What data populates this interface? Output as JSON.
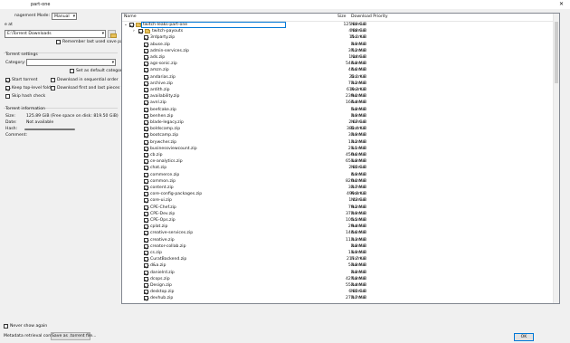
{
  "window": {
    "title": "part-one"
  },
  "management_mode": {
    "label": "nagement Mode:",
    "value": "Manual"
  },
  "save_at": {
    "label": "e at",
    "path": "E:\\Torrent Downloads"
  },
  "remember_last_path": {
    "label": "Remember last used save path",
    "checked": false
  },
  "torrent_settings": {
    "title": "Torrent settings",
    "category_label": "Category:",
    "category_value": "",
    "set_default_category": {
      "label": "Set as default category",
      "checked": false
    },
    "start_torrent": {
      "label": "Start torrent",
      "checked": true
    },
    "sequential": {
      "label": "Download in sequential order",
      "checked": false
    },
    "top_level_folder": {
      "label": "Keep top-level folder",
      "checked": true
    },
    "first_last": {
      "label": "Download first and last pieces first",
      "checked": false
    },
    "skip_hash": {
      "label": "Skip hash check",
      "checked": false
    }
  },
  "torrent_info": {
    "title": "Torrent information",
    "size_label": "Size:",
    "size_value": "125.89 GiB (Free space on disk: 819.50 GiB)",
    "date_label": "Date:",
    "date_value": "Not available",
    "hash_label": "Hash:",
    "comment_label": "Comment:"
  },
  "never_show": {
    "label": "Never show again",
    "checked": false
  },
  "status": {
    "text": "Metadata retrieval complete",
    "save_button": "Save as .torrent file..."
  },
  "ok_button": "OK",
  "tree": {
    "col_name": "Name",
    "col_size": "Size",
    "col_priority": "Download Priority",
    "root": {
      "name": "twitch-leaks-part-one",
      "size": "125.89 GiB",
      "priority": "Normal"
    },
    "folder": {
      "name": "twitch-payouts",
      "size": "4.88 GiB",
      "priority": "Normal"
    },
    "files": [
      {
        "name": "3rdparty.zip",
        "size": "15.1 KiB",
        "priority": "Normal"
      },
      {
        "name": "abuse.zip",
        "size": "3.9 MiB",
        "priority": "Normal"
      },
      {
        "name": "admin-services.zip",
        "size": "37.2 MiB",
        "priority": "Normal"
      },
      {
        "name": "ads.zip",
        "size": "1.14 GiB",
        "priority": "Normal"
      },
      {
        "name": "ags-sonic.zip",
        "size": "544.8 MiB",
        "priority": "Normal"
      },
      {
        "name": "amzn.zip",
        "size": "44.6 MiB",
        "priority": "Normal"
      },
      {
        "name": "andarias.zip",
        "size": "22.1 KiB",
        "priority": "Normal"
      },
      {
        "name": "archive.zip",
        "size": "73.2 MiB",
        "priority": "Normal"
      },
      {
        "name": "ardith.zip",
        "size": "610.3 KiB",
        "priority": "Normal"
      },
      {
        "name": "availability.zip",
        "size": "239.0 MiB",
        "priority": "Normal"
      },
      {
        "name": "avnl.zip",
        "size": "164.4 MiB",
        "priority": "Normal"
      },
      {
        "name": "beefcake.zip",
        "size": "5.8 MiB",
        "priority": "Normal"
      },
      {
        "name": "benhen.zip",
        "size": "3.9 MiB",
        "priority": "Normal"
      },
      {
        "name": "blade-legacy.zip",
        "size": "2.67 GiB",
        "priority": "Normal"
      },
      {
        "name": "boldscamp.zip",
        "size": "382.4 KiB",
        "priority": "Normal"
      },
      {
        "name": "bootcamp.zip",
        "size": "33.9 MiB",
        "priority": "Normal"
      },
      {
        "name": "brywcher.zip",
        "size": "13.2 MiB",
        "priority": "Normal"
      },
      {
        "name": "businessviewcount.zip",
        "size": "21.1 MiB",
        "priority": "Normal"
      },
      {
        "name": "cb.zip",
        "size": "450.6 MiB",
        "priority": "Normal"
      },
      {
        "name": "ce-analytics.zip",
        "size": "651.8 MiB",
        "priority": "Normal"
      },
      {
        "name": "chat.zip",
        "size": "2.85 GiB",
        "priority": "Normal"
      },
      {
        "name": "commerce.zip",
        "size": "4.9 MiB",
        "priority": "Normal"
      },
      {
        "name": "common.zip",
        "size": "820.0 MiB",
        "priority": "Normal"
      },
      {
        "name": "content.zip",
        "size": "32.7 MiB",
        "priority": "Normal"
      },
      {
        "name": "core-config-packages.zip",
        "size": "499.8 KiB",
        "priority": "Normal"
      },
      {
        "name": "core-ui.zip",
        "size": "1.43 GiB",
        "priority": "Normal"
      },
      {
        "name": "CPE-Chef.zip",
        "size": "79.2 MiB",
        "priority": "Normal"
      },
      {
        "name": "CPE-Dev.zip",
        "size": "372.9 MiB",
        "priority": "Normal"
      },
      {
        "name": "CPE-Ops.zip",
        "size": "105.5 MiB",
        "priority": "Normal"
      },
      {
        "name": "cplat.zip",
        "size": "29.4 MiB",
        "priority": "Normal"
      },
      {
        "name": "creative-services.zip",
        "size": "144.6 MiB",
        "priority": "Normal"
      },
      {
        "name": "creative.zip",
        "size": "113.3 MiB",
        "priority": "Normal"
      },
      {
        "name": "creator-collab.zip",
        "size": "2.8 MiB",
        "priority": "Normal"
      },
      {
        "name": "cs.zip",
        "size": "11.9 MiB",
        "priority": "Normal"
      },
      {
        "name": "CuratBackend.zip",
        "size": "217.7 KiB",
        "priority": "Normal"
      },
      {
        "name": "d&a.zip",
        "size": "53.8 MiB",
        "priority": "Normal"
      },
      {
        "name": "danielrd.zip",
        "size": "2.8 MiB",
        "priority": "Normal"
      },
      {
        "name": "dcops.zip",
        "size": "427.8 MiB",
        "priority": "Normal"
      },
      {
        "name": "Design.zip",
        "size": "552.4 MiB",
        "priority": "Normal"
      },
      {
        "name": "desktop.zip",
        "size": "6.85 GiB",
        "priority": "Normal"
      },
      {
        "name": "devhub.zip",
        "size": "273.7 MiB",
        "priority": "Normal"
      }
    ]
  }
}
